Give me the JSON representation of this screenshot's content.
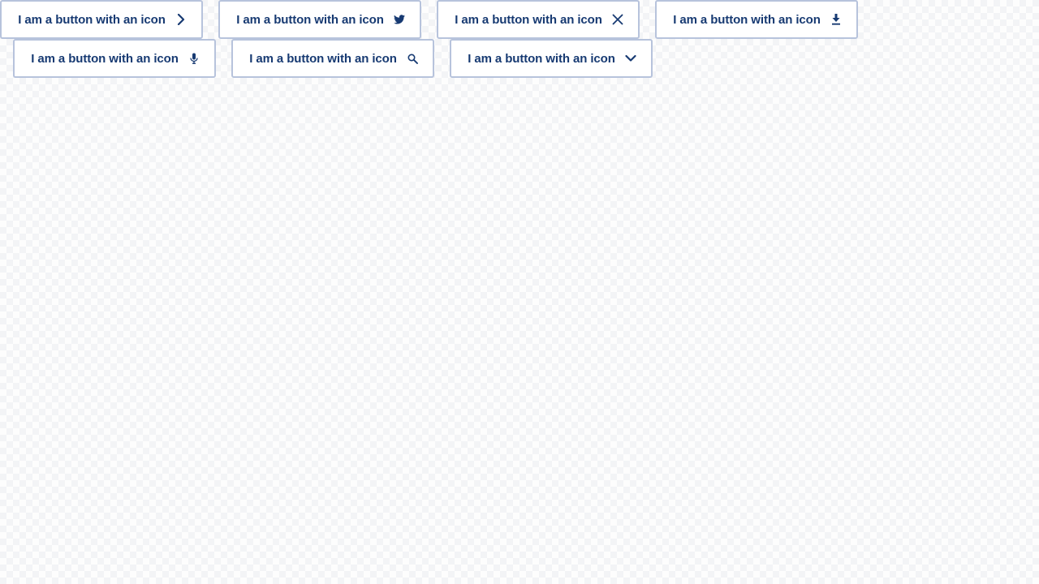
{
  "colors": {
    "text": "#173a72",
    "border": "#b7c3dc",
    "button_bg": "#ffffff"
  },
  "buttons": [
    {
      "label": "I am a button with an icon",
      "icon": "chevron-right-icon"
    },
    {
      "label": "I am a button with an icon",
      "icon": "twitter-icon"
    },
    {
      "label": "I am a button with an icon",
      "icon": "close-icon"
    },
    {
      "label": "I am a button with an icon",
      "icon": "download-icon"
    },
    {
      "label": "I am a button with an icon",
      "icon": "microphone-icon"
    },
    {
      "label": "I am a button with an icon",
      "icon": "search-icon"
    },
    {
      "label": "I am a button with an icon",
      "icon": "chevron-down-icon"
    }
  ]
}
